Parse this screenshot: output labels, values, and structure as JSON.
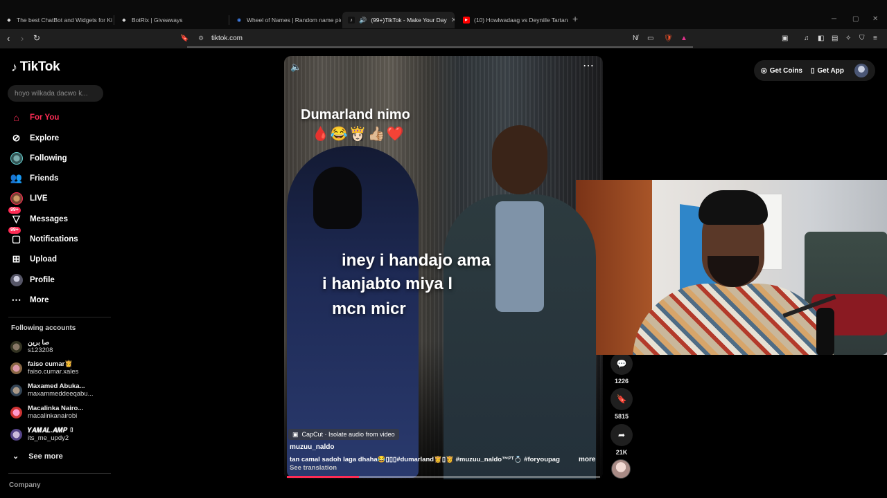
{
  "browser": {
    "tabs": [
      {
        "title": "The best ChatBot and Widgets for Ki",
        "fav_color": "#d9d9d9",
        "fav": "◆"
      },
      {
        "title": "BotRix | Giveaways",
        "fav_color": "#d9d9d9",
        "fav": "◆"
      },
      {
        "title": "Wheel of Names | Random name pic",
        "fav_color": "#4285f4",
        "fav": "◉"
      },
      {
        "title": "(99+)TikTok - Make Your Day",
        "fav_color": "#ffffff",
        "fav": "♪",
        "active": true
      },
      {
        "title": "(10) Howlwadaag vs Deyniile Tartank",
        "fav_color": "#ff0000",
        "fav": "▶"
      }
    ],
    "new_tab": "+",
    "url": "tiktok.com",
    "shield_count": "4"
  },
  "tiktok": {
    "logo_text": "TikTok",
    "search_placeholder": "hoyo wilkada dacwo k...",
    "nav": [
      {
        "label": "For You",
        "icon": "home-icon",
        "active": true
      },
      {
        "label": "Explore",
        "icon": "compass-icon"
      },
      {
        "label": "Following",
        "icon": "following-avatar-icon"
      },
      {
        "label": "Friends",
        "icon": "friends-icon"
      },
      {
        "label": "LIVE",
        "icon": "live-avatar-icon"
      },
      {
        "label": "Messages",
        "icon": "messages-icon",
        "badge": "99+"
      },
      {
        "label": "Notifications",
        "icon": "notifications-icon",
        "badge": "99+"
      },
      {
        "label": "Upload",
        "icon": "upload-icon"
      },
      {
        "label": "Profile",
        "icon": "profile-avatar-icon"
      },
      {
        "label": "More",
        "icon": "more-dots-icon"
      }
    ],
    "following_title": "Following accounts",
    "accounts": [
      {
        "name": "صا برين",
        "handle": "s123208"
      },
      {
        "name": "faiso cumar👸",
        "handle": "faiso.cumar.xales"
      },
      {
        "name": "Maxamed Abuka...",
        "handle": "maxammeddeeqabu..."
      },
      {
        "name": "Macalinka Nairo...",
        "handle": "macalinkanairobi"
      },
      {
        "name": "𝒀𝑨𝑴𝑨𝑳.𝑨𝑴𝑷 ▯",
        "handle": "its_me_updy2"
      }
    ],
    "see_more": "See more",
    "company": "Company",
    "top_right": {
      "coins": "Get Coins",
      "app": "Get App"
    }
  },
  "video": {
    "caption_top": "Dumarland nimo",
    "emojis": "🩸😂👸🏻👍🏼❤️",
    "caption_lines": [
      "iney i handajo ama",
      "i hanjabto miya l",
      "mcn micr"
    ],
    "capcut": "CapCut · Isolate audio from video",
    "author": "muzuu_naldo",
    "description": "tan camal sadoh laga dhaha😂▯▯▯#dumarland👸▯👸  #muzuu_naldo™ᴾᵀ💍  #foryoupage  ...",
    "more": "more",
    "see_translation": "See translation",
    "progress": 0.23
  },
  "actions": [
    {
      "icon": "comment-icon",
      "count": "1226",
      "glyph": "💬"
    },
    {
      "icon": "bookmark-icon",
      "count": "5815",
      "glyph": "🔖"
    },
    {
      "icon": "share-icon",
      "count": "21K",
      "glyph": "➦"
    }
  ]
}
